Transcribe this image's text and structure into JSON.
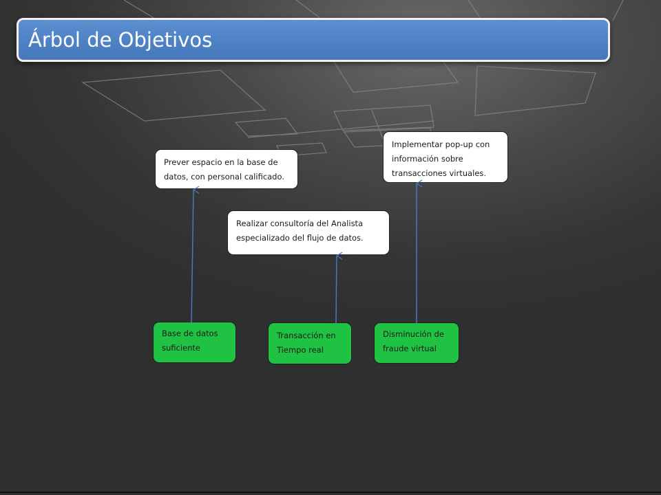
{
  "slide": {
    "title": "Árbol de Objetivos"
  },
  "objectives": [
    {
      "text": "Prever espacio en la base de datos, con personal calificado."
    },
    {
      "text": "Realizar consultoría del Analista especializado del flujo de datos."
    },
    {
      "text": "Implementar pop-up con información sobre transacciones virtuales."
    }
  ],
  "results": [
    {
      "text": "Base de datos suficiente"
    },
    {
      "text": "Transacción en Tiempo real"
    },
    {
      "text": "Disminución de fraude virtual"
    }
  ],
  "colors": {
    "title_bar": "#4a7fc1",
    "result_box": "#1fc243",
    "objective_box": "#ffffff",
    "arrow": "#4a78c0"
  }
}
